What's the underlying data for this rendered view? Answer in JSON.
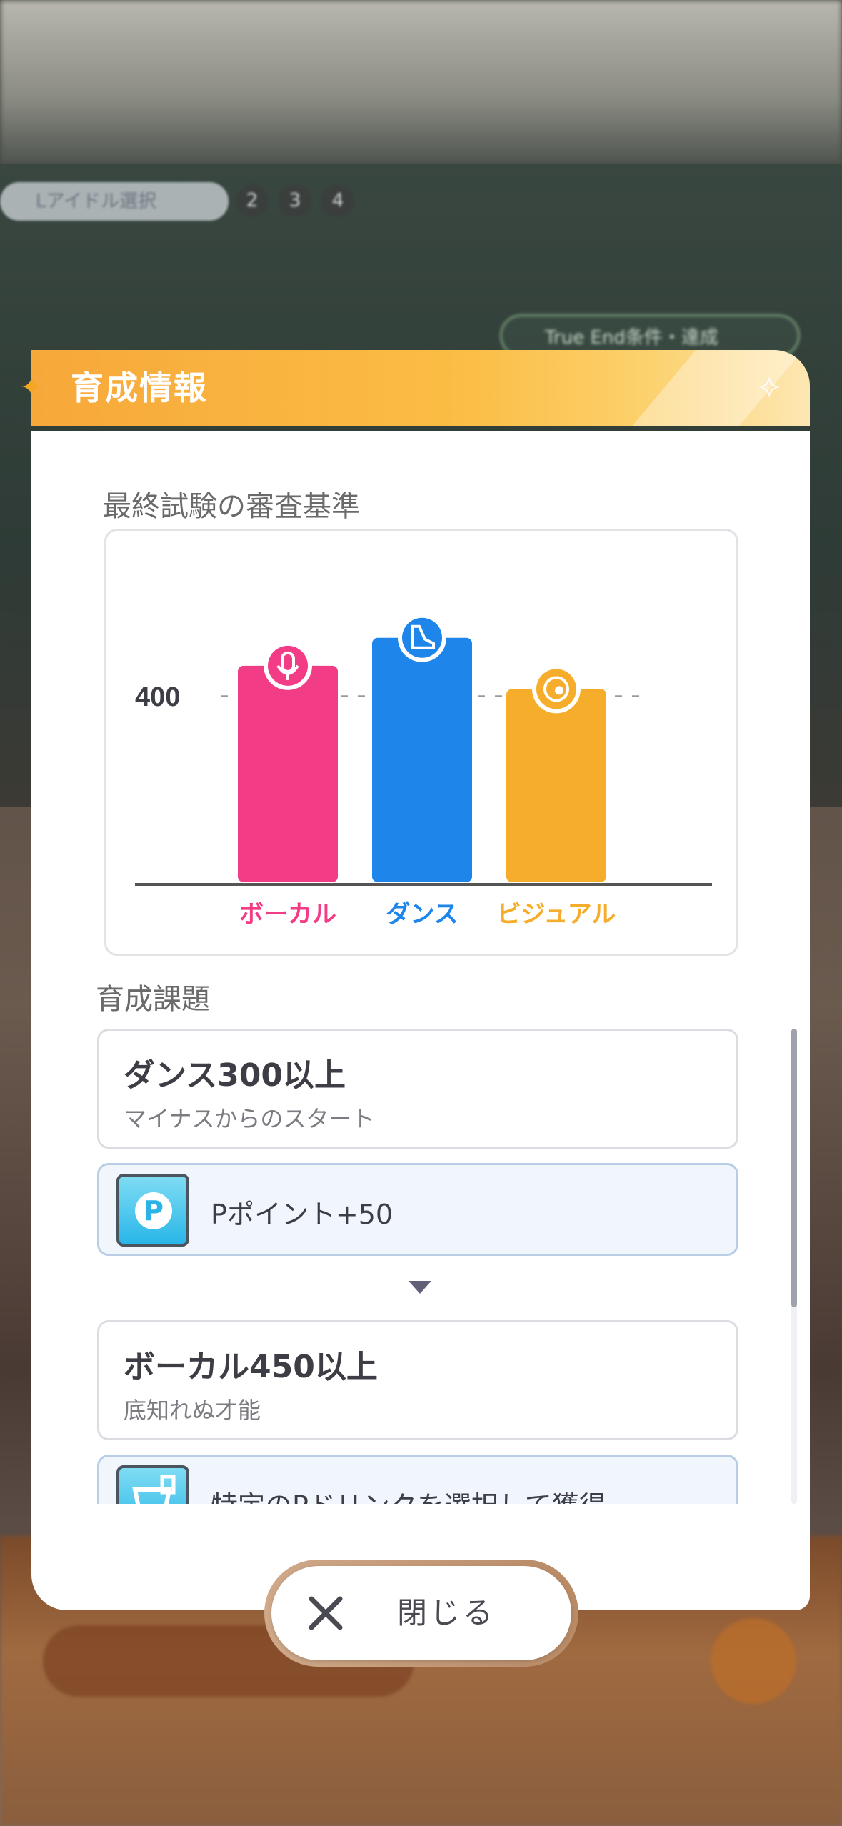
{
  "background": {
    "idol_select_label": "Lアイドル選択",
    "steps": [
      "2",
      "3",
      "4"
    ],
    "goal_label": "True End条件・達成"
  },
  "header": {
    "title": "育成情報"
  },
  "exam": {
    "section_label": "最終試験の審査基準",
    "reference_value": "400",
    "chart_data": {
      "type": "bar",
      "categories": [
        "ボーカル",
        "ダンス",
        "ビジュアル"
      ],
      "values": [
        465,
        525,
        415
      ],
      "reference_line": 400,
      "colors": [
        "#f23c86",
        "#1e86ea",
        "#f5ad2b"
      ],
      "icons": [
        "microphone-icon",
        "shoe-icon",
        "eye-icon"
      ]
    }
  },
  "tasks": {
    "section_label": "育成課題",
    "items": [
      {
        "title": "ダンス300以上",
        "subtitle": "マイナスからのスタート",
        "reward": "Pポイント+50",
        "reward_icon": "p-point-icon"
      },
      {
        "title": "ボーカル450以上",
        "subtitle": "底知れぬ才能",
        "reward": "特定のPドリンクを選択して獲得",
        "reward_icon": "drink-select-icon"
      }
    ]
  },
  "close_button": {
    "label": "閉じる"
  }
}
